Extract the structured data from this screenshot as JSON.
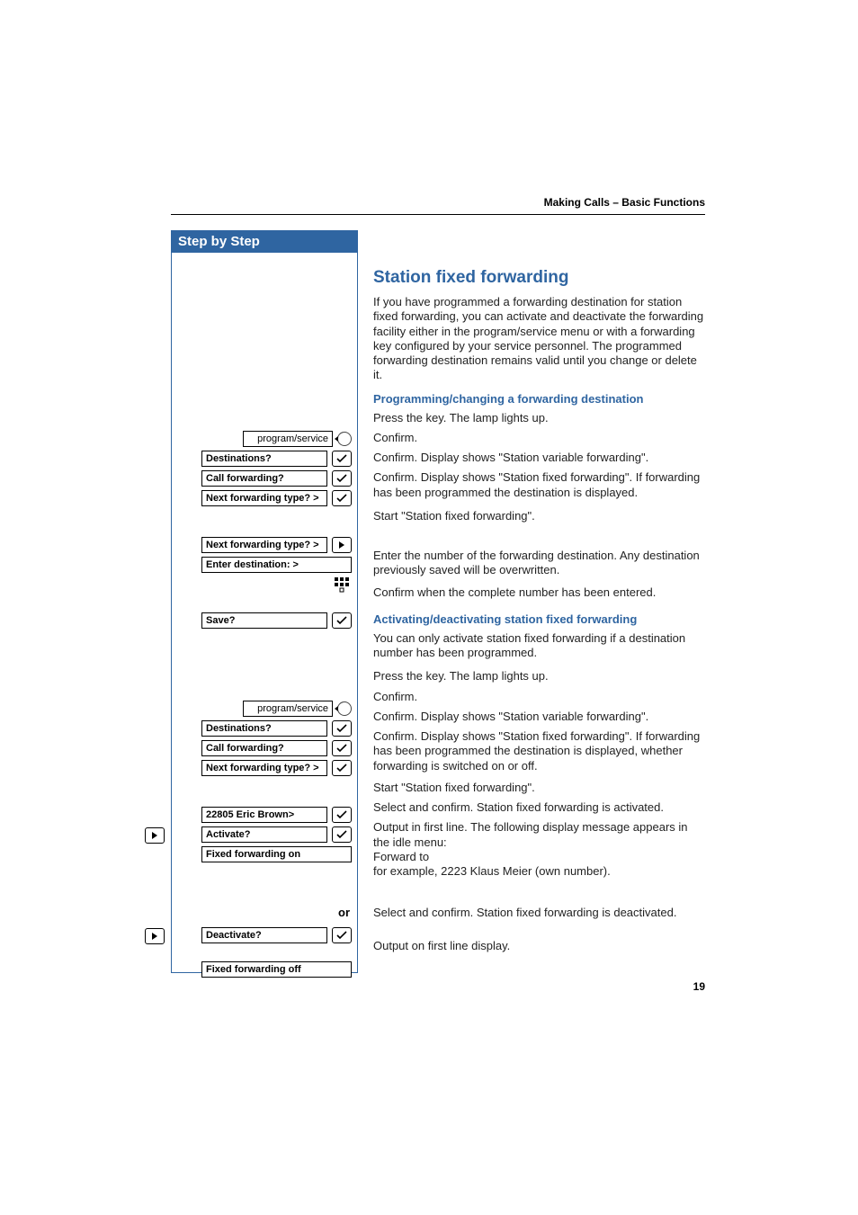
{
  "running_header": "Making Calls – Basic Functions",
  "sidebar": {
    "title": "Step by Step",
    "or_label": "or"
  },
  "section": {
    "heading": "Station fixed forwarding",
    "intro": "If you have programmed a forwarding destination for station fixed forwarding, you can activate and deactivate the forwarding facility either in the program/service menu or with a forwarding key configured by your service personnel. The programmed forwarding destination remains valid until you change or delete it.",
    "sub1_heading": "Programming/changing a forwarding destination",
    "sub2_heading": "Activating/deactivating station fixed forwarding",
    "sub2_intro": "You can only activate station fixed forwarding if a destination number has been programmed."
  },
  "labels": {
    "program_service": "program/service",
    "destinations": "Destinations?",
    "call_forwarding": "Call forwarding?",
    "next_forwarding_type": "Next forwarding type?  >",
    "enter_destination": "Enter destination:     >",
    "save": "Save?",
    "eric_brown": "22805 Eric Brown>",
    "activate": "Activate?",
    "fixed_on": "Fixed forwarding on",
    "deactivate": "Deactivate?",
    "fixed_off": "Fixed forwarding off"
  },
  "text": {
    "press_key": "Press the key. The lamp lights up.",
    "confirm": "Confirm.",
    "confirm_variable": "Confirm. Display shows \"Station variable forwarding\".",
    "confirm_fixed_played": "Confirm. Display shows \"Station fixed forwarding\". If forwarding has been programmed the destination is displayed.",
    "start_fixed": "Start \"Station fixed forwarding\".",
    "enter_number": "Enter the number of the forwarding destination. Any destination previously saved will be overwritten.",
    "confirm_saved": "Confirm when the complete number has been entered.",
    "confirm_fixed_onoff": "Confirm. Display shows \"Station fixed forwarding\". If forwarding has been programmed the destination is displayed, whether forwarding is switched on or off.",
    "select_confirm_activated": "Select and confirm. Station fixed forwarding is activated.",
    "output_first_line_msg": "Output in first line. The following display message appears in the idle menu:\nForward to\nfor example, 2223 Klaus Meier (own number).",
    "select_confirm_deactivated": "Select and confirm. Station fixed forwarding is deactivated.",
    "output_first_line": "Output on first line display."
  },
  "page_number": "19"
}
